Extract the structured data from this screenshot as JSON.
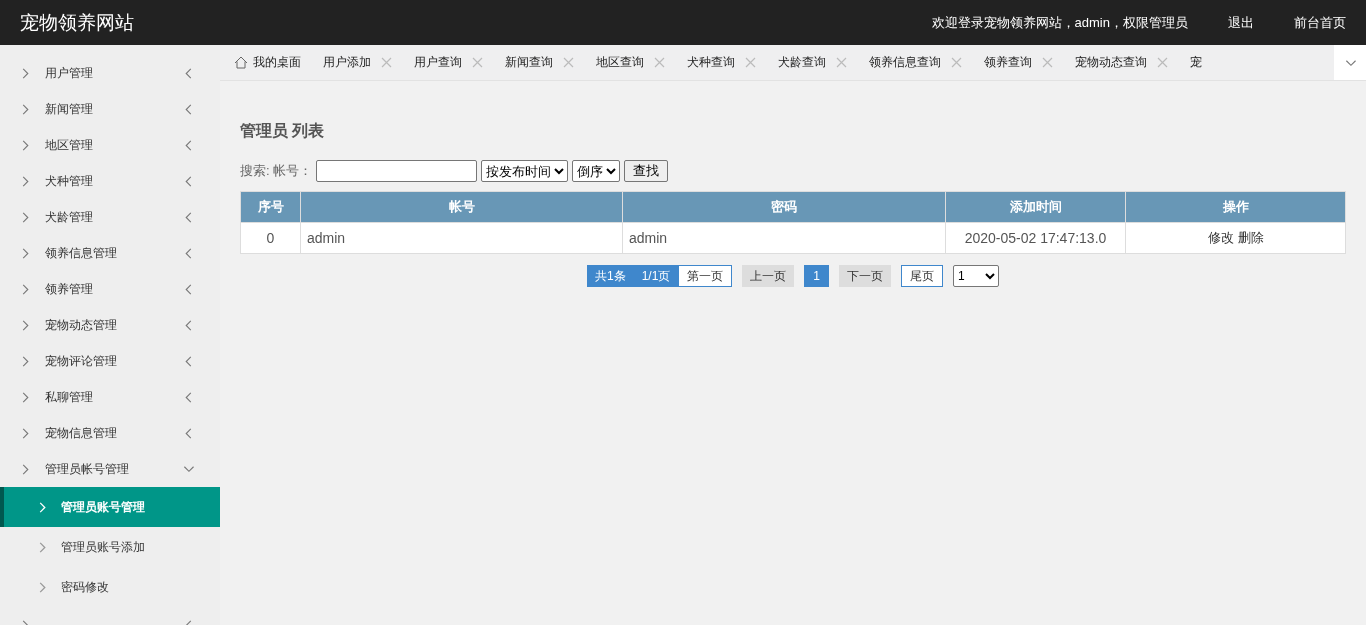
{
  "header": {
    "title": "宠物领养网站",
    "welcome": "欢迎登录宠物领养网站，admin，权限管理员",
    "links": [
      "退出",
      "前台首页"
    ]
  },
  "sidebar": {
    "items": [
      {
        "label": "用户管理",
        "expanded": false
      },
      {
        "label": "新闻管理",
        "expanded": false
      },
      {
        "label": "地区管理",
        "expanded": false
      },
      {
        "label": "犬种管理",
        "expanded": false
      },
      {
        "label": "犬龄管理",
        "expanded": false
      },
      {
        "label": "领养信息管理",
        "expanded": false
      },
      {
        "label": "领养管理",
        "expanded": false
      },
      {
        "label": "宠物动态管理",
        "expanded": false
      },
      {
        "label": "宠物评论管理",
        "expanded": false
      },
      {
        "label": "私聊管理",
        "expanded": false
      },
      {
        "label": "宠物信息管理",
        "expanded": false
      },
      {
        "label": "管理员帐号管理",
        "expanded": true,
        "children": [
          {
            "label": "管理员账号管理",
            "selected": true
          },
          {
            "label": "管理员账号添加",
            "selected": false
          },
          {
            "label": "密码修改",
            "selected": false
          }
        ]
      },
      {
        "expanded": false
      }
    ]
  },
  "tabs": [
    {
      "kind": "home",
      "label": "我的桌面"
    },
    {
      "kind": "page",
      "label": "用户添加"
    },
    {
      "kind": "page",
      "label": "用户查询"
    },
    {
      "kind": "page",
      "label": "新闻查询"
    },
    {
      "kind": "page",
      "label": "地区查询"
    },
    {
      "kind": "page",
      "label": "犬种查询"
    },
    {
      "kind": "page",
      "label": "犬龄查询"
    },
    {
      "kind": "page",
      "label": "领养信息查询"
    },
    {
      "kind": "page",
      "label": "领养查询"
    },
    {
      "kind": "page",
      "label": "宠物动态查询"
    },
    {
      "kind": "page",
      "label": "宠"
    }
  ],
  "page": {
    "title": "管理员 列表",
    "search": {
      "label": "搜索: 帐号：",
      "sort": "按发布时间",
      "order": "倒序",
      "button": "查找"
    },
    "table": {
      "columns": [
        "序号",
        "帐号",
        "密码",
        "添加时间",
        "操作"
      ],
      "rows": [
        {
          "cells": [
            "0",
            "admin",
            "admin",
            "2020-05-02 17:47:13.0"
          ],
          "actions": [
            "修改",
            "删除"
          ]
        }
      ]
    },
    "pagination": {
      "summary": [
        "共1条",
        "1/1页"
      ],
      "links": [
        {
          "label": "第一页",
          "kind": "link"
        },
        {
          "label": "上一页",
          "kind": "disabled"
        },
        {
          "label": "1",
          "kind": "current"
        },
        {
          "label": "下一页",
          "kind": "disabled"
        },
        {
          "label": "尾页",
          "kind": "link"
        }
      ],
      "page_select": "1"
    }
  }
}
